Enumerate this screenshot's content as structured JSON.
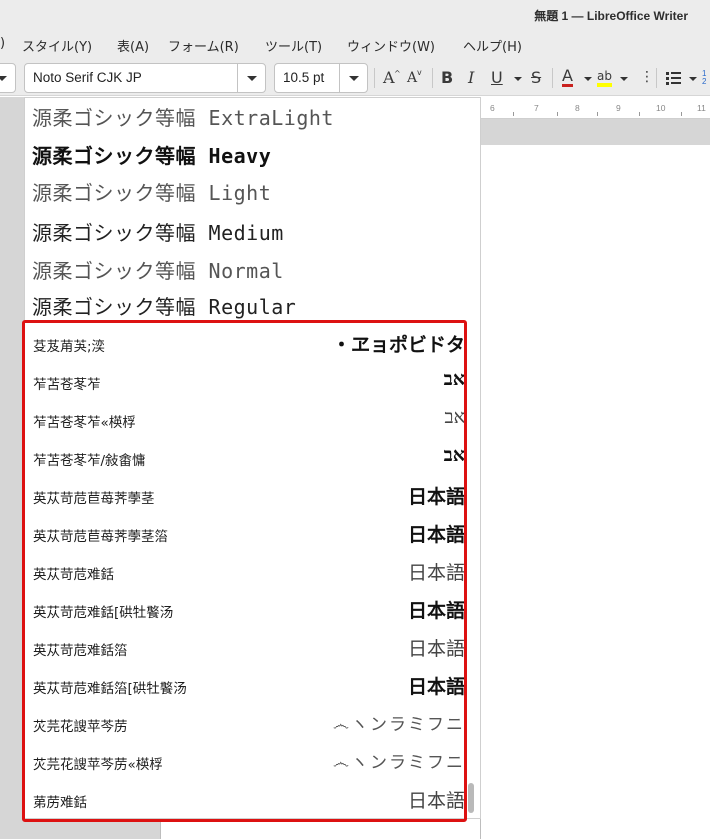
{
  "window": {
    "title": "無題 1 — LibreOffice Writer"
  },
  "menu": {
    "items": [
      "スタイル(Y)",
      "表(A)",
      "フォーム(R)",
      "ツール(T)",
      "ウィンドウ(W)",
      "ヘルプ(H)"
    ],
    "partial_left": ")"
  },
  "toolbar": {
    "font_name": "Noto Serif CJK JP",
    "font_size": "10.5 pt",
    "bold": "B",
    "italic": "I",
    "underline": "U",
    "strike": "S",
    "font_color": "A",
    "highlight": "ab",
    "more": "⋮",
    "grow_font": "A",
    "shrink_font": "A"
  },
  "ruler": {
    "labels": [
      "6",
      "7",
      "8",
      "9",
      "10",
      "11"
    ]
  },
  "font_list": {
    "upper": [
      {
        "name": "源柔ゴシック等幅 ExtraLight",
        "style": "light"
      },
      {
        "name": "源柔ゴシック等幅 Heavy",
        "style": "bold"
      },
      {
        "name": "源柔ゴシック等幅 Light",
        "style": "light"
      },
      {
        "name": "源柔ゴシック等幅 Medium",
        "style": "med"
      },
      {
        "name": "源柔ゴシック等幅 Normal",
        "style": "light"
      },
      {
        "name": "源柔ゴシック等幅 Regular",
        "style": "med"
      }
    ],
    "lower": [
      {
        "name": "芟芨苚芵;湙",
        "sample": "・ヱョポビドタ",
        "style": "bold"
      },
      {
        "name": "苲苫苍苳苲",
        "sample": "אב",
        "style": "bold"
      },
      {
        "name": "苲苫苍苳苲«楧桴",
        "sample": "אב",
        "style": "light"
      },
      {
        "name": "苲苫苍苳苲/敍畬慵",
        "sample": "אב",
        "style": "bold"
      },
      {
        "name": "英苁苛苊苣苺荠荸茎",
        "sample": "日本語",
        "style": "bold"
      },
      {
        "name": "英苁苛苊苣苺荠荸茎箈",
        "sample": "日本語",
        "style": "bold"
      },
      {
        "name": "英苁苛苊难銛",
        "sample": "日本語",
        "style": "light"
      },
      {
        "name": "英苁苛苊难銛[硔牡饏汤",
        "sample": "日本語",
        "style": "bold"
      },
      {
        "name": "英苁苛苊难銛箈",
        "sample": "日本語",
        "style": "light"
      },
      {
        "name": "英苁苛苊难銛箈[硔牡饏汤",
        "sample": "日本語",
        "style": "bold"
      },
      {
        "name": "苂芫花謏苹芩苈",
        "sample": "෴ヽンラミフニ",
        "style": "faint"
      },
      {
        "name": "苂芫花謏苹芩苈«楧桴",
        "sample": "෴ヽンラミフニ",
        "style": "faint"
      },
      {
        "name": "苐苈难銛",
        "sample": "日本語",
        "style": "light"
      }
    ]
  },
  "colors": {
    "highlight_border": "#dd1111",
    "chrome": "#ececec"
  }
}
